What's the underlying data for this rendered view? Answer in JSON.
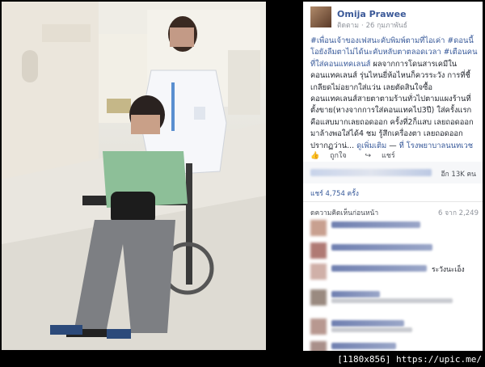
{
  "post": {
    "author": "Omija Prawee",
    "follow_label": "ติดตาม",
    "date": "26 กุมภาพันธ์",
    "privacy": "·",
    "hashtags": "#เพื่อนเจ้าของเฟสนะคับพิมพ์ตามที่ไอเค่า #ดอนนี้โอยังลืมตาไม่ได้นะคับหลับตาตลอดเวลา #เตือนคนที่ใส่คอนแทคเลนส์",
    "body": "ผลจากการโดนสารเคมีในคอนแทคเลนส์ รุ่นไหนยี่ห้อไหนก็ควรระวัง การที่ชี้เกลียดไม่อยากใส่แว่น เลยตัดสินใจซื้อคอนแทคเลนส์สายตาตามร้านทั่วไปตามแผงร้านที่ตั้งขาย(หางจากการใส่คอนแทคไป3ปี) ใส่ครั้งแรกคือแสบมากเลยถอดออก ครั้งที่2ก็แสบ เลยถอดออกมาล้างพอใส่ได้4 ชม รู้สึกเครื่องตา เลยถอดออก ปรากฏว่าน่...",
    "see_more": "ดูเพิ่มเติม",
    "location_sep": "—",
    "location": "ที่ โรงพยาบาลนนทเวช"
  },
  "actions": {
    "like": "ถูกใจ",
    "share": "แชร์"
  },
  "reactions": {
    "others_count": "อีก 13K คน"
  },
  "shares_label": "แชร์ 4,754 ครั้ง",
  "comments": {
    "header": "ดความคิดเห็นก่อนหน้า",
    "count": "6 จาก 2,249",
    "visible_text": "ระวังนะเอ็ง"
  },
  "watermark": "[1180x856] https://upic.me/"
}
